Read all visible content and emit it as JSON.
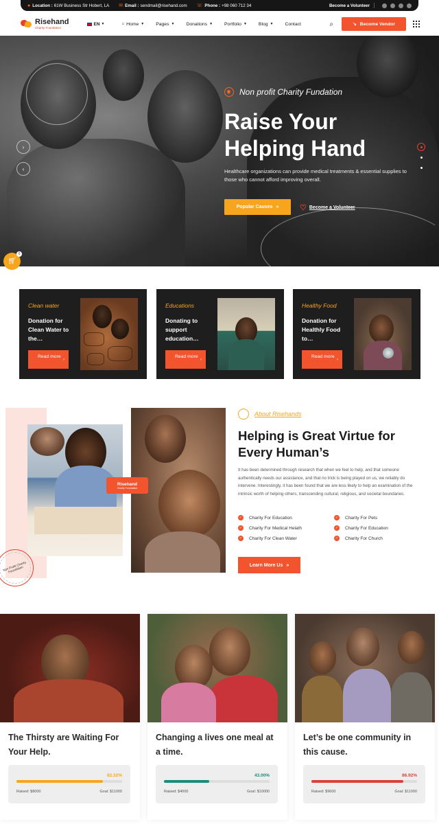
{
  "topbar": {
    "location_label": "Location :",
    "location_value": "61W Business Str Hobert, LA",
    "email_label": "Email :",
    "email_value": "sendmail@risehand.com",
    "phone_label": "Phone :",
    "phone_value": "+98 060 712 34",
    "volunteer": "Become a Volunteer"
  },
  "brand": {
    "name": "Risehand",
    "tagline": "Charity Foundation"
  },
  "nav": {
    "lang": "EN",
    "items": [
      {
        "label": "Home"
      },
      {
        "label": "Pages"
      },
      {
        "label": "Donations"
      },
      {
        "label": "Portfolio"
      },
      {
        "label": "Blog"
      },
      {
        "label": "Contact"
      }
    ],
    "vendor_button": "Become Vendor"
  },
  "hero": {
    "tagline": "Non profit Charity Fundation",
    "title_line1": "Raise Your",
    "title_line2": "Helping Hand",
    "description": "Healthcare organizations can provide medical treatments & essential supplies to those who cannot afford improving overall.",
    "primary_button": "Popular Causes",
    "secondary_link": "Become a Volunteer",
    "cart_count": "0"
  },
  "causes": [
    {
      "category": "Clean water",
      "title": "Donation for Clean Water to the…",
      "button": "Read more"
    },
    {
      "category": "Educations",
      "title": "Donating to support education…",
      "button": "Read more"
    },
    {
      "category": "Healthy Food",
      "title": "Donation for Healthly Food to…",
      "button": "Read more"
    }
  ],
  "about": {
    "tag": "About Risehands",
    "title": "Helping is Great Virtue for Every Human’s",
    "text": "It has been determined through research that when we feel to help, and that someone authentically needs our assistance, and that no trick is being played on us, we reliably do intervene. Interestingly, it has been found that we are less likely to help an examination of the intrinsic worth of helping others, transcending cultural, religious, and societal boundaries.",
    "list": [
      "Charity For Education",
      "Charity For Pets",
      "Charity For Medical Helath",
      "Charity For Education",
      "Charity For Clean Water",
      "Charity For Church"
    ],
    "button": "Learn More Us",
    "badge_name": "Risehand",
    "badge_sub": "Charity Foundation",
    "stamp_text": "Non Profit Charity Foundation"
  },
  "donations": [
    {
      "title": "The Thirsty are Waiting For Your Help.",
      "percent": "82.32%",
      "progress": 0.82,
      "raised": "Raised: $8000",
      "goal": "Goal: $11000",
      "color": "#f7a51c"
    },
    {
      "title": "Changing a lives one meal at a time.",
      "percent": "43.00%",
      "progress": 0.43,
      "raised": "Raised: $4000",
      "goal": "Goal: $10000",
      "color": "#1a8c7a"
    },
    {
      "title": "Let’s be one community in this cause.",
      "percent": "86.92%",
      "progress": 0.87,
      "raised": "Raised: $9600",
      "goal": "Goal: $11000",
      "color": "#d9413a"
    }
  ],
  "colors": {
    "accent": "#f2542d",
    "secondary": "#f7a51c",
    "dark": "#1e1e1e"
  }
}
